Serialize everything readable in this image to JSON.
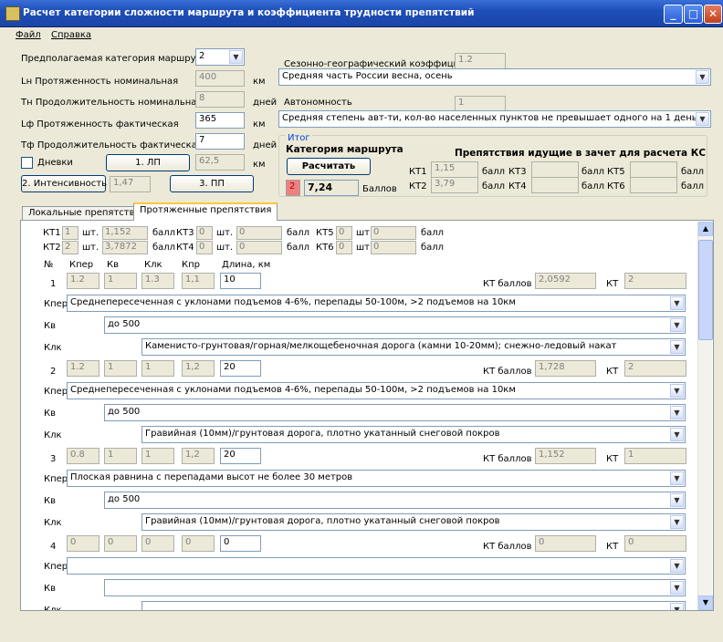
{
  "window": {
    "title": "Расчет категории сложности маршрута и коэффициента трудности препятствий"
  },
  "menu": {
    "file": "Файл",
    "help": "Справка"
  },
  "params": {
    "category_label": "Предполагаемая категория маршрута",
    "category_value": "2",
    "ln_label": "Lн Протяженность номинальная",
    "ln_value": "400",
    "ln_unit": "км",
    "tn_label": "Tн Продолжительность номинальная",
    "tn_value": "8",
    "tn_unit": "дней",
    "lf_label": "Lф Протяженность фактическая",
    "lf_value": "365",
    "lf_unit": "км",
    "tf_label": "Tф Продолжительность фактическая",
    "tf_value": "7",
    "tf_unit": "дней",
    "dnevki_label": "Дневки",
    "lp_button": "1. ЛП",
    "lp_value": "62,5",
    "lp_unit": "км",
    "intensity_button": "2. Интенсивность",
    "intensity_value": "1,47",
    "pp_button": "3. ПП"
  },
  "season": {
    "label": "Сезонно-географический коэффициент",
    "value": "1.2",
    "selected": "Средняя часть России весна, осень"
  },
  "autonomy": {
    "label": "Автономность",
    "value": "1",
    "selected": "Средняя степень авт-ти, кол-во населенных пунктов не превышает одного на 1 день"
  },
  "result": {
    "group_label": "Итог",
    "category_heading": "Категория маршрута",
    "calc_button": "Расчитать",
    "category_value": "2",
    "score_value": "7,24",
    "score_unit": "Баллов",
    "ks_heading": "Препятствия идущие в зачет для расчета КС",
    "kt1_label": "КТ1",
    "kt1_value": "1,15",
    "kt2_label": "КТ2",
    "kt2_value": "3,79",
    "kt3_label": "КТ3",
    "kt3_value": "",
    "kt4_label": "КТ4",
    "kt4_value": "",
    "kt5_label": "КТ5",
    "kt5_value": "",
    "kt6_label": "КТ6",
    "kt6_value": "",
    "unit": "балл"
  },
  "tabs": {
    "local": "Локальные препятствия",
    "extended": "Протяженные препятствия"
  },
  "summary": {
    "kt1_label": "КТ1",
    "kt1_count": "1",
    "kt1_score": "1,152",
    "kt2_label": "КТ2",
    "kt2_count": "2",
    "kt2_score": "3,7872",
    "kt3_label": "КТ3",
    "kt3_count": "0",
    "kt3_score": "0",
    "kt4_label": "КТ4",
    "kt4_count": "0",
    "kt4_score": "0",
    "kt5_label": "КТ5",
    "kt5_count": "0",
    "kt5_score": "0",
    "kt6_label": "КТ6",
    "kt6_count": "0",
    "kt6_score": "0",
    "count_unit": "шт.",
    "score_unit": "балл"
  },
  "columns": {
    "num": "№",
    "kper": "Кпер",
    "kv": "Кв",
    "klk": "Клк",
    "kpr": "Кпр",
    "length": "Длина, км"
  },
  "row_labels": {
    "kper": "Кпер",
    "kv": "Кв",
    "klk": "Клк",
    "kt_score": "КТ баллов",
    "kt": "КТ"
  },
  "obstacles": [
    {
      "num": "1",
      "kper": "1.2",
      "kv": "1",
      "klk": "1.3",
      "kpr": "1,1",
      "length": "10",
      "kt_score": "2,0592",
      "kt": "2",
      "kper_sel": "Среднепересеченная с уклонами подъемов 4-6%, перепады 50-100м, >2 подъемов на 10км",
      "kv_sel": "до 500",
      "klk_sel": "Каменисто-грунтовая/горная/мелкощебеночная дорога (камни 10-20мм); снежно-ледовый накат"
    },
    {
      "num": "2",
      "kper": "1.2",
      "kv": "1",
      "klk": "1",
      "kpr": "1,2",
      "length": "20",
      "kt_score": "1,728",
      "kt": "2",
      "kper_sel": "Среднепересеченная с уклонами подъемов 4-6%, перепады 50-100м, >2 подъемов на 10км",
      "kv_sel": "до 500",
      "klk_sel": "Гравийная (10мм)/грунтовая дорога, плотно укатанный снеговой покров"
    },
    {
      "num": "3",
      "kper": "0.8",
      "kv": "1",
      "klk": "1",
      "kpr": "1,2",
      "length": "20",
      "kt_score": "1,152",
      "kt": "1",
      "kper_sel": "Плоская равнина с перепадами высот не более 30 метров",
      "kv_sel": "до 500",
      "klk_sel": "Гравийная (10мм)/грунтовая дорога, плотно укатанный снеговой покров"
    },
    {
      "num": "4",
      "kper": "0",
      "kv": "0",
      "klk": "0",
      "kpr": "0",
      "length": "0",
      "kt_score": "0",
      "kt": "0",
      "kper_sel": "",
      "kv_sel": "",
      "klk_sel": ""
    }
  ],
  "colors": {
    "titlebar": "#1e4fb8",
    "highlight": "#f08080",
    "tab_accent": "#ffc83c"
  }
}
